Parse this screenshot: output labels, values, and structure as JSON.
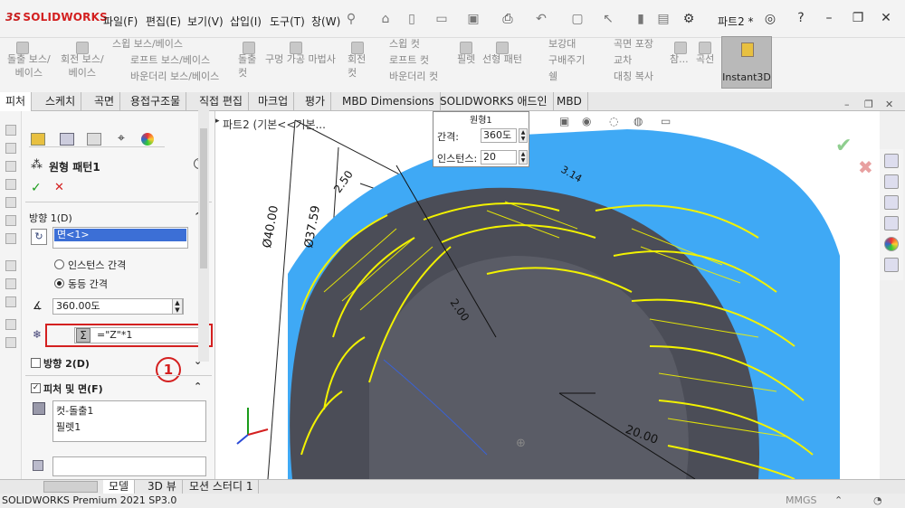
{
  "app": {
    "logo": "SOLIDWORKS",
    "logo_mark": "3S",
    "doc_name": "파트2 *"
  },
  "menu": [
    "파일(F)",
    "편집(E)",
    "보기(V)",
    "삽입(I)",
    "도구(T)",
    "창(W)"
  ],
  "ribbon": {
    "col1": [
      "돌출 보스/",
      "베이스"
    ],
    "col2": [
      "회전 보스/",
      "베이스"
    ],
    "col3": [
      "스윕 보스/베이스",
      "로프트 보스/베이스",
      "바운더리 보스/베이스"
    ],
    "col4": [
      "돌출",
      "컷"
    ],
    "col5": [
      "구멍 가공 마법사"
    ],
    "col6": [
      "회전",
      "컷"
    ],
    "col7": [
      "스윕 컷",
      "로프트 컷",
      "바운더리 컷"
    ],
    "col8": [
      "필렛"
    ],
    "col9": [
      "선형 패턴"
    ],
    "col10": [
      "보강대",
      "구배주기",
      "쉘"
    ],
    "col11": [
      "곡면 포장",
      "교차",
      "대칭 복사"
    ],
    "col12": [
      "참..."
    ],
    "col13": [
      "곡선"
    ],
    "instant3d": "Instant3D"
  },
  "tabs": [
    "피처",
    "스케치",
    "곡면",
    "용접구조물",
    "직접 편집",
    "마크업",
    "평가",
    "MBD Dimensions",
    "SOLIDWORKS 애드인",
    "MBD"
  ],
  "panel": {
    "title": "원형 패턴1",
    "dir1": "방향 1(D)",
    "face": "면<1>",
    "radio_instance": "인스턴스 간격",
    "radio_equal": "동등 간격",
    "angle": "360.00도",
    "equation": "=\"Z\"*1",
    "dir2": "방향 2(D)",
    "features_label": "피처 및 면(F)",
    "features": [
      "컷-돌출1",
      "필렛1"
    ],
    "marker": "1"
  },
  "viewport": {
    "tree_node": "파트2  (기본<<기본...",
    "callout": {
      "title": "원형1",
      "spacing_label": "간격:",
      "spacing_value": "360도",
      "instances_label": "인스턴스:",
      "instances_value": "20"
    },
    "dims": [
      "Ø40.00",
      "Ø37.59",
      "2.50",
      "2.00",
      "20.00",
      "3.14"
    ],
    "colors": {
      "gear_face": "#4b4d57",
      "gear_side": "#3fa9f5",
      "highlight": "#f2f200",
      "dim": "#d42020"
    }
  },
  "bottom_tabs": [
    "모델",
    "3D 뷰",
    "모션 스터디 1"
  ],
  "status": {
    "left": "SOLIDWORKS Premium 2021 SP3.0",
    "units": "MMGS"
  }
}
